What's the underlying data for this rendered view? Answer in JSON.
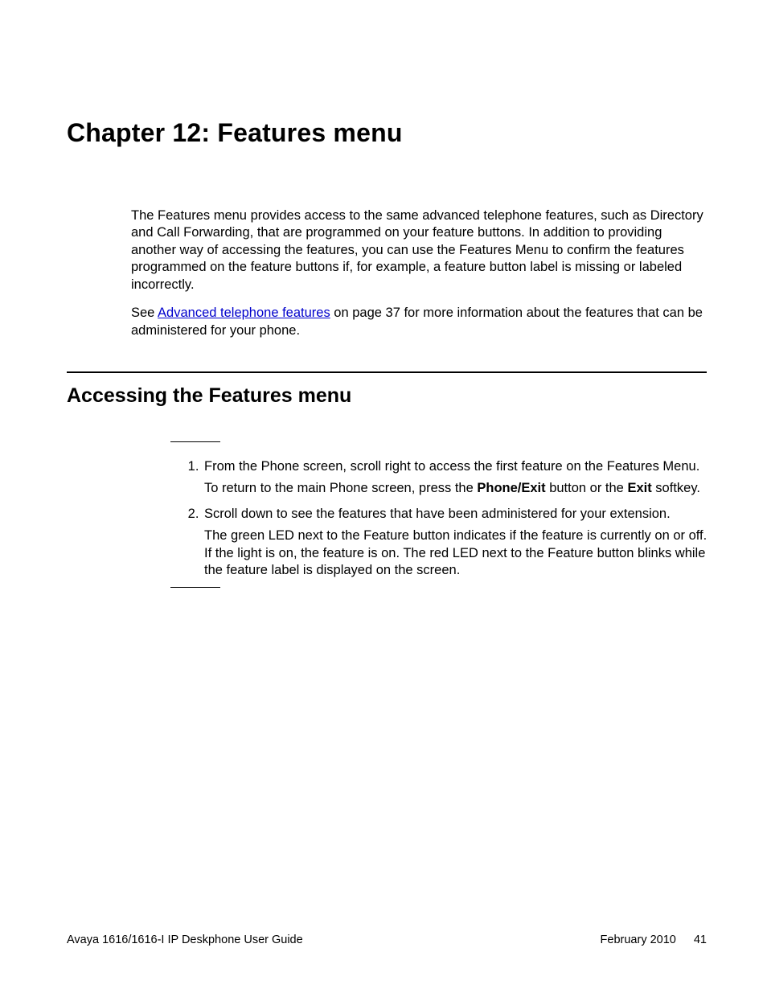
{
  "chapter_title": "Chapter 12: Features menu",
  "intro": {
    "p1": "The Features menu provides access to the same advanced telephone features, such as Directory and Call Forwarding, that are programmed on your feature buttons. In addition to providing another way of accessing the features, you can use the Features Menu to confirm the features programmed on the feature buttons if, for example, a feature button label is missing or labeled incorrectly.",
    "p2_pre": "See ",
    "p2_link": "Advanced telephone features",
    "p2_post": " on page 37 for more information about the features that can be administered for your phone."
  },
  "section_title": "Accessing the Features menu",
  "steps": {
    "s1a": "From the Phone screen, scroll right to access the first feature on the Features Menu.",
    "s1b_pre": "To return to the main Phone screen, press the ",
    "s1b_bold1": "Phone/Exit",
    "s1b_mid": " button or the ",
    "s1b_bold2": "Exit",
    "s1b_post": " softkey.",
    "s2a": "Scroll down to see the features that have been administered for your extension.",
    "s2b": "The green LED next to the Feature button indicates if the feature is currently on or off. If the light is on, the feature is on. The red LED next to the Feature button blinks while the feature label is displayed on the screen."
  },
  "footer": {
    "left": "Avaya 1616/1616-I IP Deskphone User Guide",
    "date": "February 2010",
    "page": "41"
  }
}
